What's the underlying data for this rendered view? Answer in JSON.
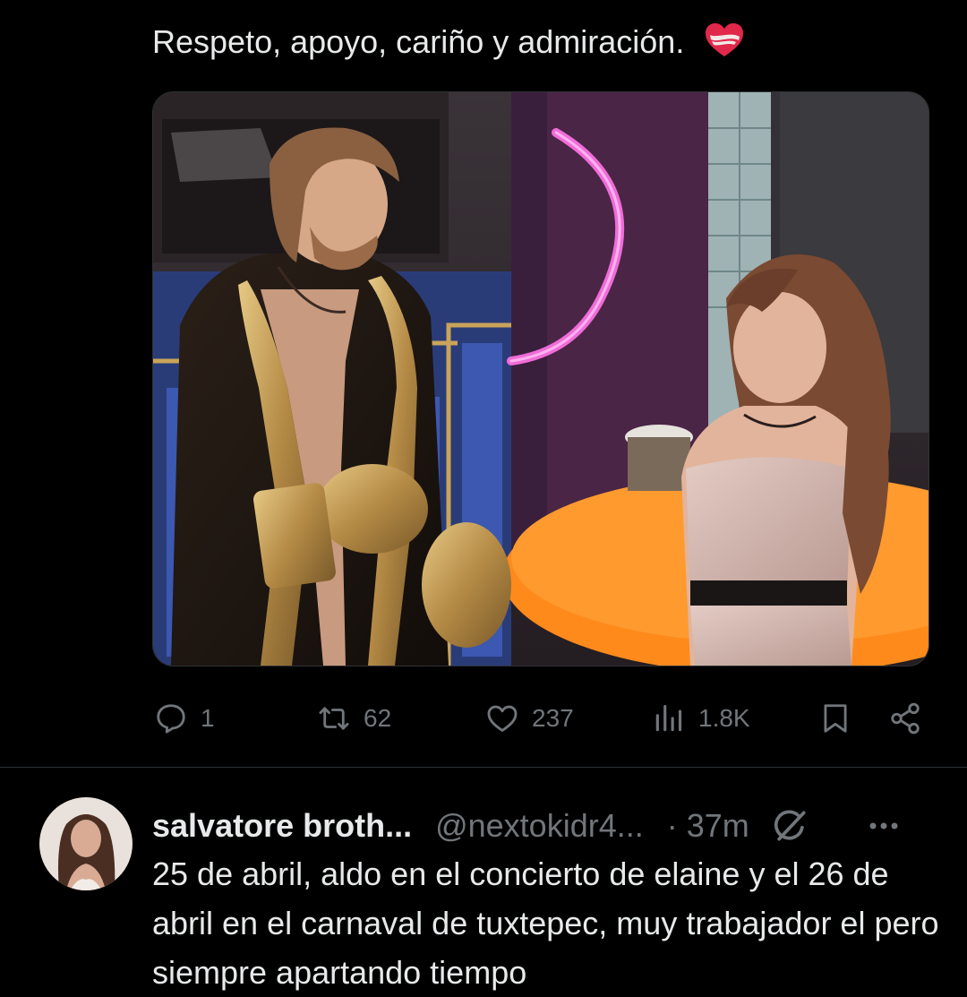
{
  "tweet": {
    "text": "Respeto, apoyo, cariño y admiración.",
    "emoji": "mending-heart-emoji",
    "media": {
      "kind": "photo"
    }
  },
  "actions": {
    "reply": {
      "icon": "reply-icon",
      "count": "1"
    },
    "retweet": {
      "icon": "retweet-icon",
      "count": "62"
    },
    "like": {
      "icon": "heart-icon",
      "count": "237"
    },
    "views": {
      "icon": "views-icon",
      "count": "1.8K"
    },
    "bookmark": {
      "icon": "bookmark-icon"
    },
    "share": {
      "icon": "share-icon"
    }
  },
  "reply": {
    "display_name": "salvatore broth...",
    "handle": "@nextokidr4...",
    "separator": "·",
    "time": "37m",
    "text": "25 de abril, aldo en el concierto de elaine y el 26 de abril en el carnaval de tuxtepec, muy trabajador el pero siempre apartando tiempo"
  },
  "colors": {
    "background": "#000000",
    "text": "#e7e9ea",
    "muted": "#71767b",
    "divider": "#2f3336"
  }
}
